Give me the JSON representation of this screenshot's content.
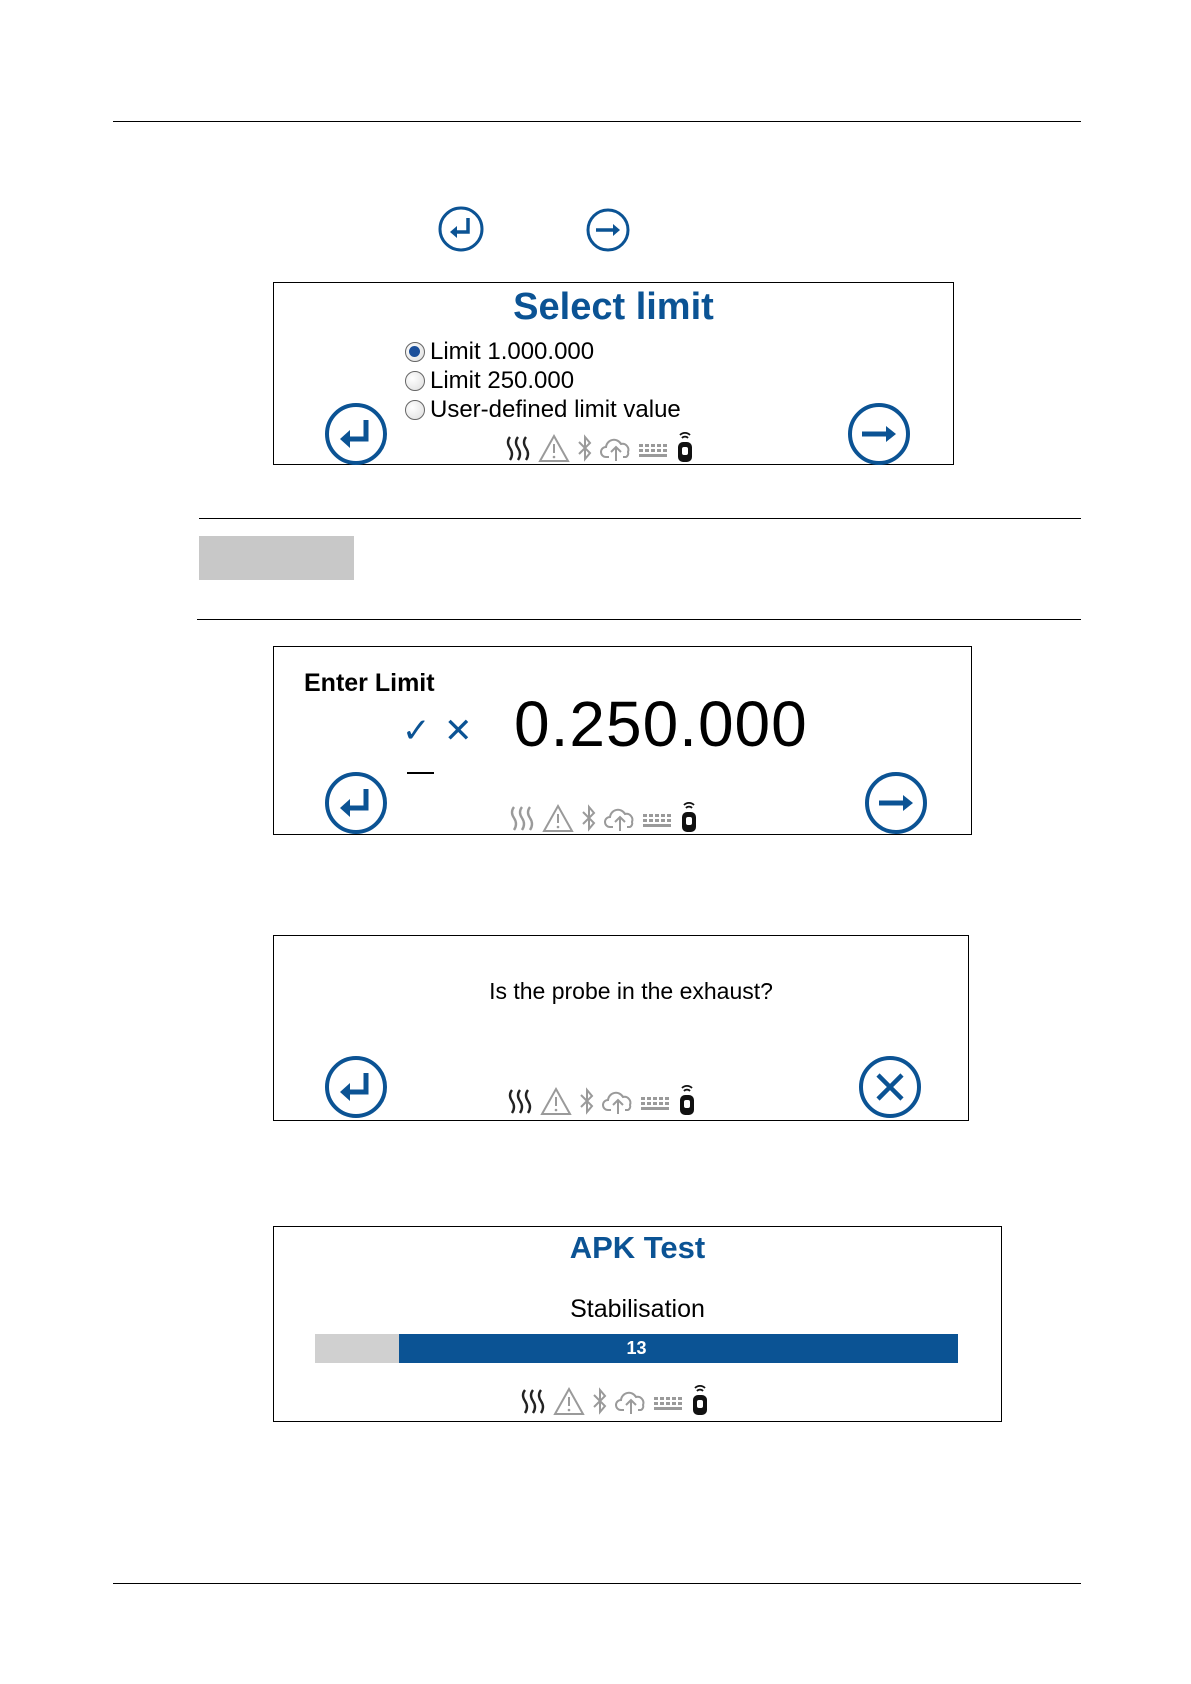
{
  "colors": {
    "accent": "#0b5394",
    "progress_fill": "#0b5394",
    "progress_track": "#d0d0d0",
    "icon_gray": "#9a9a9a"
  },
  "icons": {
    "enter": "enter-return-icon",
    "next": "arrow-right-icon",
    "cancel": "close-icon",
    "status": [
      "heat-waves-icon",
      "warning-icon",
      "bluetooth-icon",
      "cloud-upload-icon",
      "keyboard-icon",
      "probe-icon"
    ]
  },
  "select_limit": {
    "title": "Select limit",
    "options": [
      {
        "label": "Limit 1.000.000",
        "selected": true
      },
      {
        "label": "Limit 250.000",
        "selected": false
      },
      {
        "label": "User-defined limit value",
        "selected": false
      }
    ]
  },
  "enter_limit": {
    "label": "Enter Limit",
    "check_symbol": "✓",
    "cross_symbol": "✕",
    "value": "0.250.000"
  },
  "probe_question": {
    "text": "Is the probe in the exhaust?"
  },
  "apk_test": {
    "title": "APK Test",
    "phase": "Stabilisation",
    "progress_label": "13",
    "progress_fraction": 0.87
  }
}
